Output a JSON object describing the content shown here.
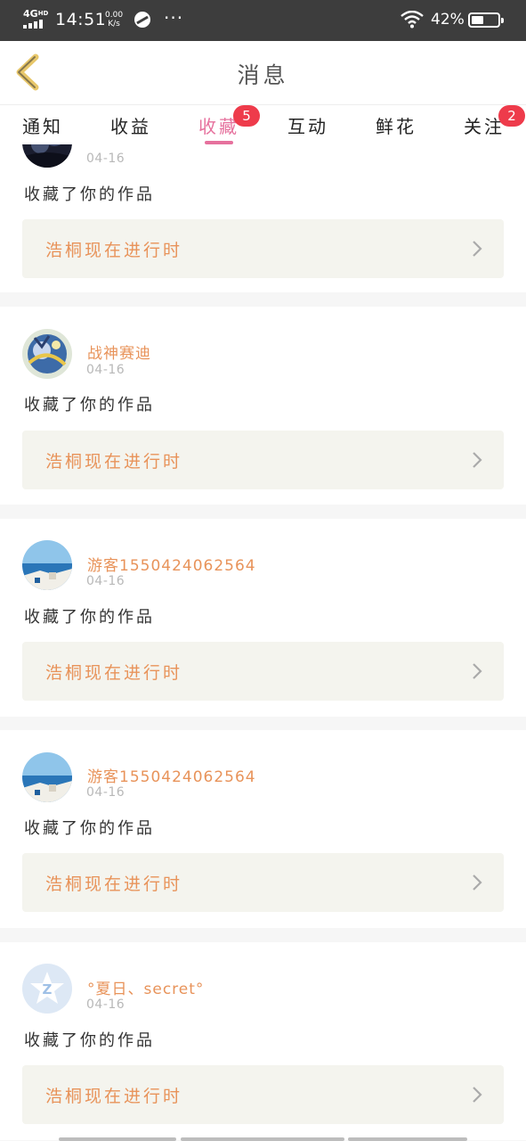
{
  "status_bar": {
    "network": "4G",
    "network_sup": "HD",
    "time": "14:51",
    "speed_value": "0.00",
    "speed_unit": "K/s",
    "dots": "···",
    "battery_percent": "42%"
  },
  "header": {
    "title": "消息"
  },
  "tabs": [
    {
      "label": "通知",
      "badge": null
    },
    {
      "label": "收益",
      "badge": null
    },
    {
      "label": "收藏",
      "badge": "5",
      "active": true
    },
    {
      "label": "互动",
      "badge": null
    },
    {
      "label": "鲜花",
      "badge": null
    },
    {
      "label": "关注",
      "badge": "2"
    }
  ],
  "messages": [
    {
      "username": "",
      "date": "04-16",
      "action": "收藏了你的作品",
      "work_title": "浩桐现在进行时",
      "avatar": "night-sky"
    },
    {
      "username": "战神赛迪",
      "date": "04-16",
      "action": "收藏了你的作品",
      "work_title": "浩桐现在进行时",
      "avatar": "anime-art"
    },
    {
      "username": "游客1550424062564",
      "date": "04-16",
      "action": "收藏了你的作品",
      "work_title": "浩桐现在进行时",
      "avatar": "seaside"
    },
    {
      "username": "游客1550424062564",
      "date": "04-16",
      "action": "收藏了你的作品",
      "work_title": "浩桐现在进行时",
      "avatar": "seaside"
    },
    {
      "username": "°夏日、secret°",
      "date": "04-16",
      "action": "收藏了你的作品",
      "work_title": "浩桐现在进行时",
      "avatar": "qzone-default"
    }
  ],
  "colors": {
    "accent_pink": "#e6719d",
    "name_orange": "#e8935a",
    "badge_red": "#ee3b4b",
    "back_arrow": "#e8c76a"
  }
}
